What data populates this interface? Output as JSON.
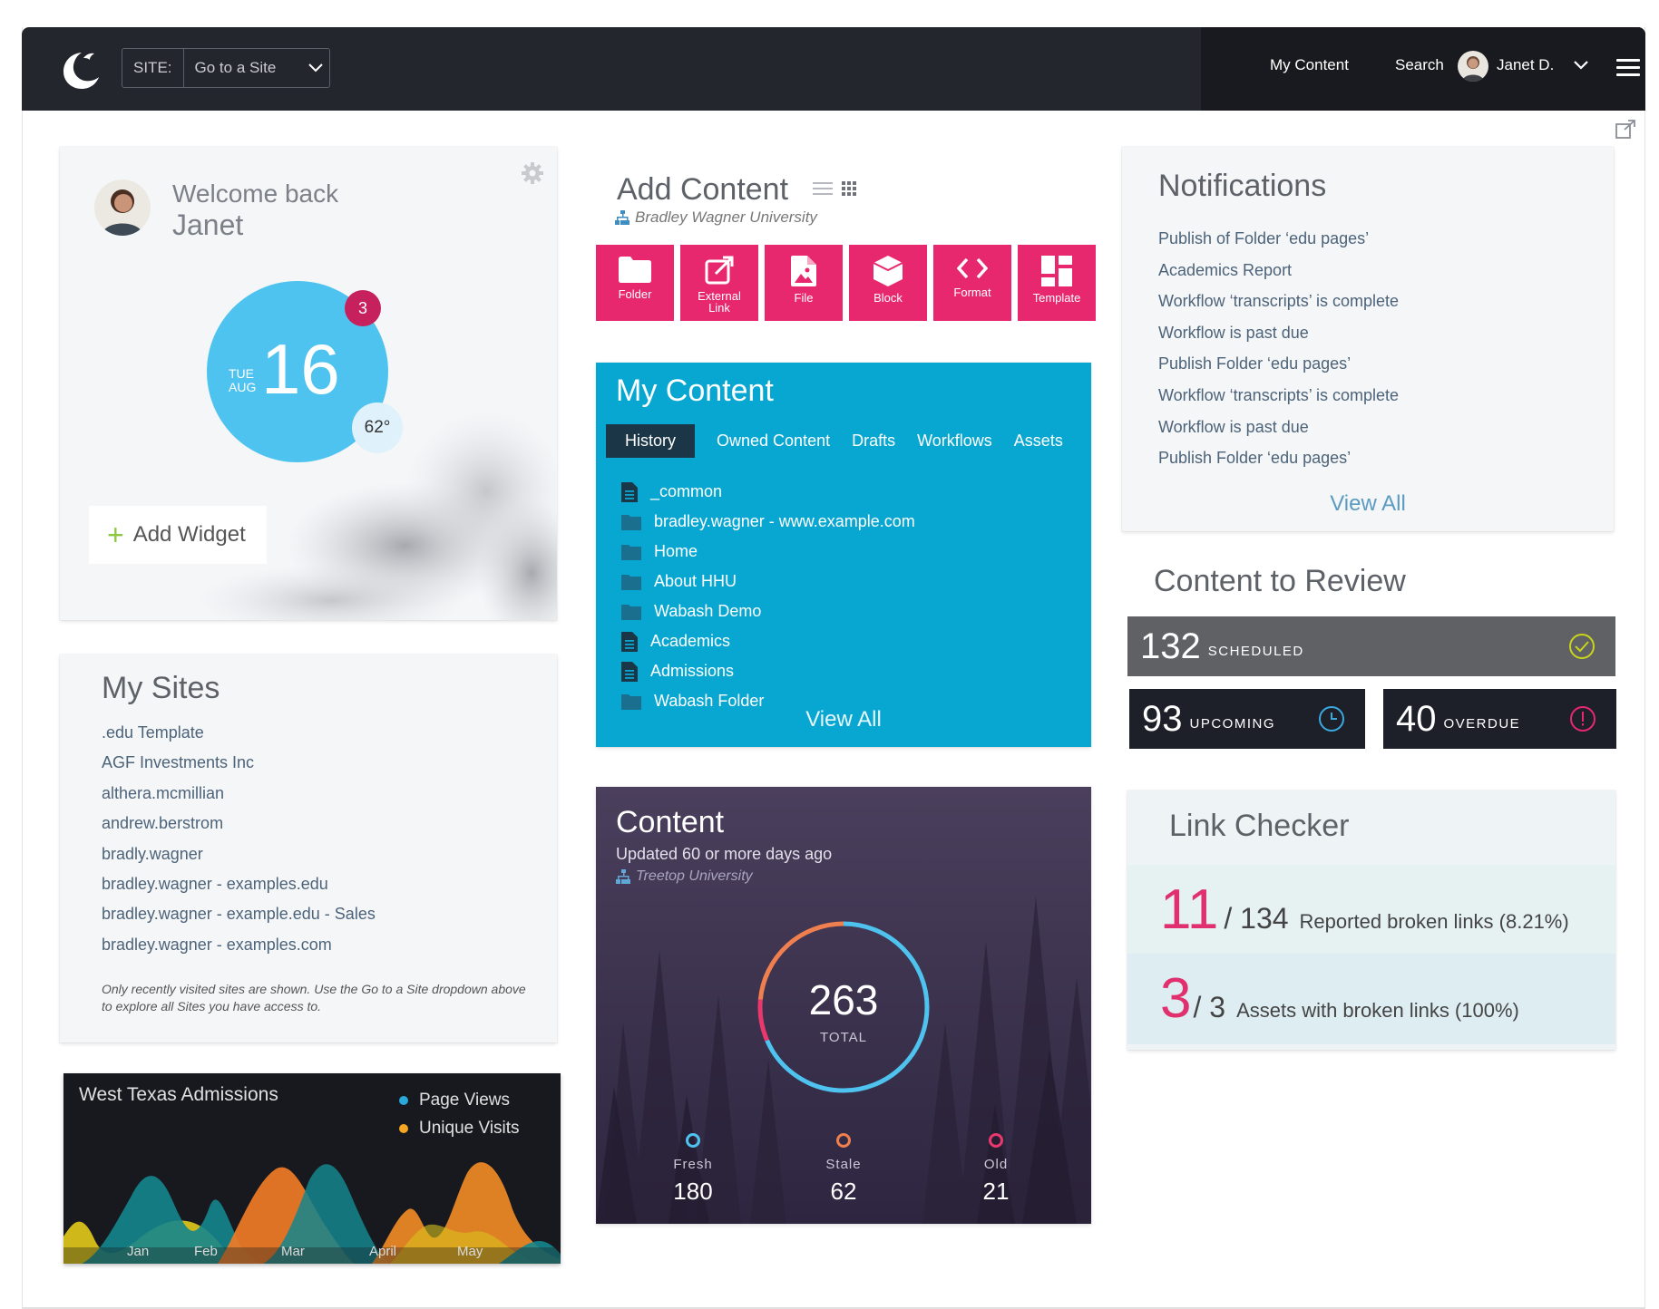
{
  "topbar": {
    "site_label": "SITE:",
    "site_placeholder": "Go to a Site",
    "nav_my_content": "My Content",
    "nav_search": "Search",
    "user_name": "Janet D."
  },
  "welcome": {
    "greeting": "Welcome back",
    "name": "Janet",
    "day": "TUE",
    "month": "AUG",
    "date": "16",
    "badge": "3",
    "temperature": "62°",
    "add_widget": "Add Widget"
  },
  "add_content": {
    "title": "Add Content",
    "org": "Bradley Wagner University",
    "tiles": [
      {
        "label": "Folder"
      },
      {
        "label": "External Link"
      },
      {
        "label": "File"
      },
      {
        "label": "Block"
      },
      {
        "label": "Format"
      },
      {
        "label": "Template"
      }
    ]
  },
  "my_content": {
    "title": "My Content",
    "tabs": [
      "History",
      "Owned Content",
      "Drafts",
      "Workflows",
      "Assets"
    ],
    "items": [
      {
        "type": "page",
        "label": "_common"
      },
      {
        "type": "folder",
        "label": "bradley.wagner - www.example.com"
      },
      {
        "type": "folder",
        "label": "Home"
      },
      {
        "type": "folder",
        "label": "About HHU"
      },
      {
        "type": "folder",
        "label": "Wabash Demo"
      },
      {
        "type": "page",
        "label": "Academics"
      },
      {
        "type": "page",
        "label": "Admissions"
      },
      {
        "type": "folder",
        "label": "Wabash Folder"
      }
    ],
    "view_all": "View All"
  },
  "content_stats": {
    "title": "Content",
    "subtitle": "Updated 60 or more days ago",
    "org": "Treetop University",
    "total": "263",
    "total_label": "TOTAL",
    "stats": [
      {
        "label": "Fresh",
        "value": "180",
        "color": "#4fc3ef"
      },
      {
        "label": "Stale",
        "value": "62",
        "color": "#f07f4f"
      },
      {
        "label": "Old",
        "value": "21",
        "color": "#e8386e"
      }
    ]
  },
  "my_sites": {
    "title": "My Sites",
    "sites": [
      ".edu Template",
      "AGF Investments Inc",
      "althera.mcmillian",
      "andrew.berstrom",
      "bradly.wagner",
      "bradley.wagner - examples.edu",
      "bradley.wagner - example.edu - Sales",
      "bradley.wagner - examples.com"
    ],
    "note": "Only recently visited sites are shown. Use the Go to a Site dropdown above to explore all Sites you have access to."
  },
  "chart_data": {
    "type": "area",
    "title": "West Texas Admissions",
    "categories": [
      "Jan",
      "Feb",
      "Mar",
      "April",
      "May"
    ],
    "series": [
      {
        "name": "Page Views",
        "color": "#1a8a8f"
      },
      {
        "name": "Unique Visits",
        "color": "#f5a623"
      }
    ]
  },
  "notifications": {
    "title": "Notifications",
    "items": [
      "Publish of Folder ‘edu pages’",
      "Academics Report",
      "Workflow ‘transcripts’ is complete",
      "Workflow is past due",
      "Publish Folder ‘edu pages’",
      "Workflow ‘transcripts’ is complete",
      "Workflow is past due",
      "Publish Folder ‘edu pages’"
    ],
    "view_all": "View All"
  },
  "content_review": {
    "title": "Content to Review",
    "scheduled": {
      "count": "132",
      "label": "SCHEDULED"
    },
    "upcoming": {
      "count": "93",
      "label": "UPCOMING"
    },
    "overdue": {
      "count": "40",
      "label": "OVERDUE"
    }
  },
  "link_checker": {
    "title": "Link Checker",
    "rows": [
      {
        "count": "11",
        "total": "/ 134",
        "text": "Reported broken links (8.21%)"
      },
      {
        "count": "3",
        "total": "/ 3",
        "text": "Assets with broken links (100%)"
      }
    ]
  }
}
